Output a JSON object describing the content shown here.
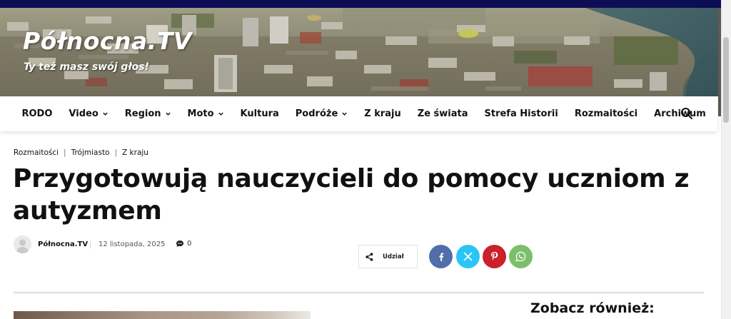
{
  "site": {
    "title": "Północna.TV",
    "tagline": "Ty też masz swój głos!"
  },
  "nav": {
    "items": [
      {
        "label": "RODO",
        "dropdown": false
      },
      {
        "label": "Video",
        "dropdown": true
      },
      {
        "label": "Region",
        "dropdown": true
      },
      {
        "label": "Moto",
        "dropdown": true
      },
      {
        "label": "Kultura",
        "dropdown": false
      },
      {
        "label": "Podróże",
        "dropdown": true
      },
      {
        "label": "Z kraju",
        "dropdown": false
      },
      {
        "label": "Ze świata",
        "dropdown": false
      },
      {
        "label": "Strefa Historii",
        "dropdown": false
      },
      {
        "label": "Rozmaitości",
        "dropdown": false
      },
      {
        "label": "Archiwum",
        "dropdown": false
      }
    ],
    "search_icon": "search-icon"
  },
  "breadcrumb": [
    "Rozmaitości",
    "Trójmiasto",
    "Z kraju"
  ],
  "article": {
    "title": "Przygotowują nauczycieli do pomocy uczniom z autyzmem",
    "author": "Północna.TV",
    "date": "12 listopada, 2025",
    "comments": "0"
  },
  "share": {
    "label": "Udział",
    "buttons": [
      {
        "name": "facebook",
        "icon": "facebook-icon",
        "color": "#516eab"
      },
      {
        "name": "x",
        "icon": "x-icon",
        "color": "#29c5f6"
      },
      {
        "name": "pinterest",
        "icon": "pinterest-icon",
        "color": "#ca212a"
      },
      {
        "name": "whatsapp",
        "icon": "whatsapp-icon",
        "color": "#7bbf6a"
      }
    ]
  },
  "sidebar": {
    "heading": "Zobacz również:"
  },
  "colors": {
    "top_strip": "#0d0d55",
    "text": "#111111"
  }
}
